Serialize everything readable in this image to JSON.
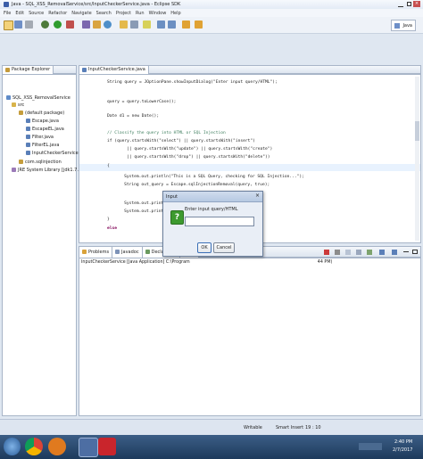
{
  "window": {
    "title": "Java - SQL_XSS_RemovalService/src/InputCheckerService.java - Eclipse SDK"
  },
  "menu": [
    "File",
    "Edit",
    "Source",
    "Refactor",
    "Navigate",
    "Search",
    "Project",
    "Run",
    "Window",
    "Help"
  ],
  "toolbar": {
    "perspective_label": "Java"
  },
  "explorer": {
    "tab_label": "Package Explorer",
    "tree": [
      {
        "label": "SQL_XSS_RemovalService",
        "level": 0
      },
      {
        "label": "src",
        "level": 1
      },
      {
        "label": "(default package)",
        "level": 2
      },
      {
        "label": "Escape.java",
        "level": 3
      },
      {
        "label": "EscapeEL.java",
        "level": 3
      },
      {
        "label": "Filter.java",
        "level": 3
      },
      {
        "label": "FilterEL.java",
        "level": 3
      },
      {
        "label": "InputCheckerService.java",
        "level": 3
      },
      {
        "label": "com.sqlinjection",
        "level": 2
      },
      {
        "label": "JRE System Library [jdk1.7.0_51]",
        "level": 1
      }
    ]
  },
  "editor": {
    "tab_label": "InputCheckerService.java",
    "lines": [
      "String query = JOptionPane.showInputDialog(\"Enter input query/HTML\");",
      "",
      "query = query.toLowerCase();",
      "",
      "Date d1 = new Date();",
      "",
      "// Classify the query into HTML or SQL Injection",
      "if (query.startsWith(\"select\") || query.startsWith(\"insert\")",
      "        || query.startsWith(\"update\") || query.startsWith(\"create\")",
      "        || query.startsWith(\"drop\") || query.startsWith(\"delete\"))",
      "{",
      "    System.out.println(\"This is a SQL Query, checking for SQL Injection...\");",
      "    String out_query = Escape.sqlInjectionRemoval(query, true);",
      "",
      "    System.out.println(\"I",
      "    System.out.println(\"O",
      "}",
      "else"
    ]
  },
  "console": {
    "tabs": [
      "Problems",
      "Javadoc",
      "Declaration",
      "Co"
    ],
    "header": "InputCheckerService [Java Application] C:\\Program",
    "header_tail": "44 PM)"
  },
  "dialog": {
    "title": "Input",
    "prompt": "Enter input query/HTML",
    "input_value": "",
    "ok_label": "OK",
    "cancel_label": "Cancel"
  },
  "status": {
    "writable": "Writable",
    "insert_mode": "Smart Insert",
    "position": "19 : 10"
  },
  "taskbar": {
    "time": "2:40 PM",
    "date": "2/7/2017"
  }
}
